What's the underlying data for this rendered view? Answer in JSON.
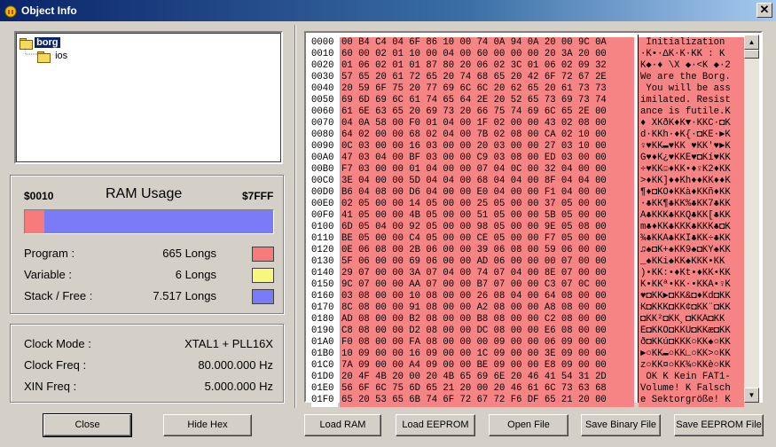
{
  "window": {
    "title": "Object Info"
  },
  "tree": {
    "root": "borg",
    "child": "ios"
  },
  "ram": {
    "start_addr": "$0010",
    "title": "RAM Usage",
    "end_addr": "$7FFF",
    "program_fraction": 0.08,
    "rows": [
      {
        "label": "Program :",
        "value": "665 Longs",
        "color": "#f77b7b"
      },
      {
        "label": "Variable :",
        "value": "6 Longs",
        "color": "#f7f77b"
      },
      {
        "label": "Stack / Free :",
        "value": "7.517 Longs",
        "color": "#7b7bf7"
      }
    ]
  },
  "clock": {
    "rows": [
      {
        "label": "Clock Mode :",
        "value": "XTAL1 + PLL16X"
      },
      {
        "label": "Clock Freq :",
        "value": "80.000.000 Hz"
      },
      {
        "label": "XIN Freq :",
        "value": "5.000.000 Hz"
      }
    ]
  },
  "hex": {
    "lines": [
      {
        "addr": "0000",
        "data": "00 B4 C4 04 6F 86 10 00 74 0A 94 0A 20 00 9C 0A",
        "ascii": " Initialization"
      },
      {
        "addr": "0010",
        "data": "60 00 02 01 10 00 04 00 60 00 00 00 20 3A 20 00",
        "ascii": "·K•·∆K·K·KK : K"
      },
      {
        "addr": "0020",
        "data": "01 06 02 01 01 87 80 20 06 02 3C 01 06 02 09 32",
        "ascii": "K◆·♦ \\X ◆·<K ◆·2"
      },
      {
        "addr": "0030",
        "data": "57 65 20 61 72 65 20 74 68 65 20 42 6F 72 67 2E",
        "ascii": "We are the Borg."
      },
      {
        "addr": "0040",
        "data": "20 59 6F 75 20 77 69 6C 6C 20 62 65 20 61 73 73",
        "ascii": " You will be ass"
      },
      {
        "addr": "0050",
        "data": "69 6D 69 6C 61 74 65 64 2E 20 52 65 73 69 73 74",
        "ascii": "imilated. Resist"
      },
      {
        "addr": "0060",
        "data": "61 6E 63 65 20 69 73 20 66 75 74 69 6C 65 2E 00",
        "ascii": "ance is futile.K"
      },
      {
        "addr": "0070",
        "data": "04 0A 58 00 F0 01 04 00 1F 02 00 00 43 02 08 00",
        "ascii": "♦ XKðK♦K▼·KKC·◘K"
      },
      {
        "addr": "0080",
        "data": "64 02 00 00 68 02 04 00 7B 02 08 00 CA 02 10 00",
        "ascii": "d·KKh·♦K{·◘KÊ·►K"
      },
      {
        "addr": "0090",
        "data": "0C 03 00 00 16 03 00 00 20 03 00 00 27 03 10 00",
        "ascii": "♀♥KK▬♥KK ♥KK'♥►K"
      },
      {
        "addr": "00A0",
        "data": "47 03 04 00 BF 03 00 00 C9 03 08 00 ED 03 00 00",
        "ascii": "G♥♦K¿♥KKÉ♥◘Kí♥KK"
      },
      {
        "addr": "00B0",
        "data": "F7 03 00 00 01 04 00 00 07 04 0C 00 32 04 00 00",
        "ascii": "÷♥KK☺♦KK•♦♀K2♦KK"
      },
      {
        "addr": "00C0",
        "data": "3E 04 00 00 5D 04 04 00 68 04 04 00 8F 04 04 00",
        "ascii": ">♦KK]♦♦Kh♦♦KK♦♦K"
      },
      {
        "addr": "00D0",
        "data": "B6 04 08 00 D6 04 00 00 E0 04 00 00 F1 04 00 00",
        "ascii": "¶♦◘KÖ♦KKà♦KKñ♦KK"
      },
      {
        "addr": "00E0",
        "data": "02 05 00 00 14 05 00 00 25 05 00 00 37 05 00 00",
        "ascii": "·♣KK¶♣KK%♣KK7♣KK"
      },
      {
        "addr": "00F0",
        "data": "41 05 00 00 4B 05 00 00 51 05 00 00 5B 05 00 00",
        "ascii": "A♣KKK♣KKQ♣KK[♣KK"
      },
      {
        "addr": "0100",
        "data": "6D 05 04 00 92 05 00 00 98 05 00 00 9E 05 08 00",
        "ascii": "m♣♦KK♣KKK♣KKK♣◘K"
      },
      {
        "addr": "0110",
        "data": "BE 05 00 00 C4 05 00 00 CE 05 00 00 F7 05 00 00",
        "ascii": "¾♣KKÄ♣KKÎ♣KK÷♣KK"
      },
      {
        "addr": "0120",
        "data": "0E 06 08 00 2B 06 00 00 39 06 08 00 59 06 00 00",
        "ascii": "♫♠◘K+♠KK9♠◘KY♠KK"
      },
      {
        "addr": "0130",
        "data": "5F 06 00 00 69 06 00 00 AD 06 00 00 00 07 00 00",
        "ascii": "_♠KKi♠KK­♠KKK•KK"
      },
      {
        "addr": "0140",
        "data": "29 07 00 00 3A 07 04 00 74 07 04 00 8E 07 00 00",
        "ascii": ")•KK:•♦Kt•♦KK•KK"
      },
      {
        "addr": "0150",
        "data": "9C 07 00 00 AA 07 00 00 B7 07 00 00 C3 07 0C 00",
        "ascii": "K•KKª•KK·•KKÃ•♀K"
      },
      {
        "addr": "0160",
        "data": "03 08 00 00 10 08 00 00 26 08 04 00 64 08 00 00",
        "ascii": "♥◘KK►◘KK&◘♦Kd◘KK"
      },
      {
        "addr": "0170",
        "data": "8C 08 00 00 91 08 00 00 A2 08 00 00 A8 08 00 00",
        "ascii": "K◘KKK◘KK¢◘KK¨◘KK"
      },
      {
        "addr": "0180",
        "data": "AD 08 00 00 B2 08 00 00 B8 08 00 00 C2 08 00 00",
        "ascii": "­◘KK²◘KK¸◘KKÂ◘KK"
      },
      {
        "addr": "0190",
        "data": "C8 08 00 00 D2 08 00 00 DC 08 00 00 E6 08 00 00",
        "ascii": "È◘KKÒ◘KKÜ◘KKæ◘KK"
      },
      {
        "addr": "01A0",
        "data": "F0 08 00 00 FA 08 00 00 00 09 00 00 06 09 00 00",
        "ascii": "ð◘KKú◘KKK○KK♠○KK"
      },
      {
        "addr": "01B0",
        "data": "10 09 00 00 16 09 00 00 1C 09 00 00 3E 09 00 00",
        "ascii": "►○KK▬○KK∟○KK>○KK"
      },
      {
        "addr": "01C0",
        "data": "7A 09 00 00 A4 09 00 00 BE 09 00 00 E8 09 00 00",
        "ascii": "z○KK¤○KK¾○KKè○KK"
      },
      {
        "addr": "01D0",
        "data": "20 4F 4B 20 00 20 4B 65 69 6E 20 46 41 54 31 2D",
        "ascii": " OK K Kein FAT1-"
      },
      {
        "addr": "01E0",
        "data": "56 6F 6C 75 6D 65 21 20 00 20 46 61 6C 73 63 68",
        "ascii": "Volume! K Falsch"
      },
      {
        "addr": "01F0",
        "data": "65 20 53 65 6B 74 6F 72 67 72 F6 DF 65 21 20 00",
        "ascii": "e Sektorgröße! K"
      }
    ]
  },
  "buttons": {
    "close": "Close",
    "hide_hex": "Hide Hex",
    "load_ram": "Load RAM",
    "load_eeprom": "Load EEPROM",
    "open_file": "Open File",
    "save_binary": "Save Binary File",
    "save_eeprom": "Save EEPROM File"
  }
}
